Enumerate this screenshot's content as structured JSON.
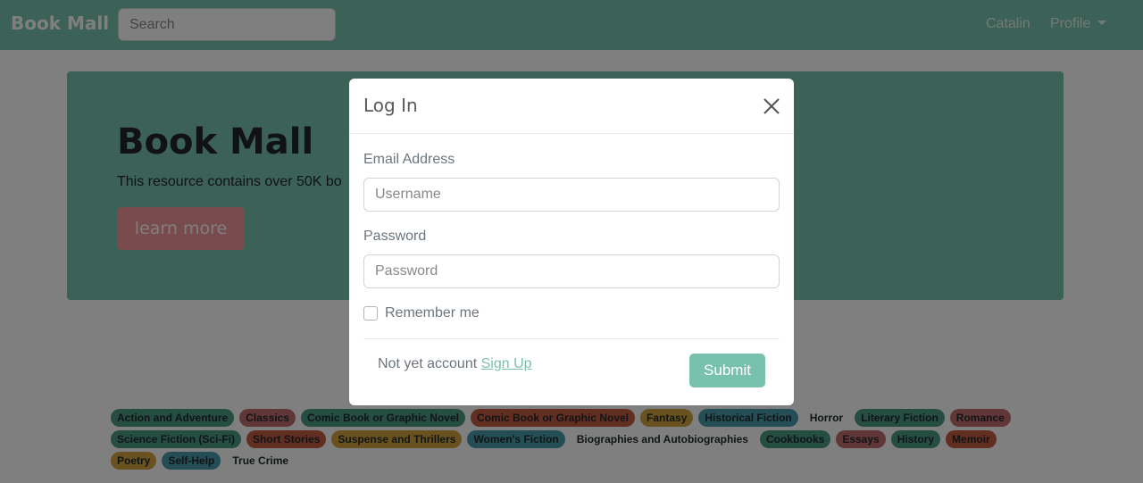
{
  "navbar": {
    "brand": "Book Mall",
    "search_placeholder": "Search",
    "user": "Catalin",
    "profile": "Profile"
  },
  "hero": {
    "title": "Book Mall",
    "text": "This resource contains over 50K bo",
    "button": "learn more"
  },
  "modal": {
    "title": "Log In",
    "email_label": "Email Address",
    "email_placeholder": "Username",
    "password_label": "Password",
    "password_placeholder": "Password",
    "remember_label": "Remember me",
    "signup_text": "Not yet account",
    "signup_link": "Sign Up",
    "submit": "Submit"
  },
  "tags": [
    {
      "label": "Action and Adventure",
      "color": "#4a9a84"
    },
    {
      "label": "Classics",
      "color": "#c06d71"
    },
    {
      "label": "Comic Book or Graphic Novel",
      "color": "#4a9a84"
    },
    {
      "label": "Comic Book or Graphic Novel",
      "color": "#c75c45"
    },
    {
      "label": "Fantasy",
      "color": "#d4a441"
    },
    {
      "label": "Historical Fiction",
      "color": "#4a9aaa"
    },
    {
      "label": "Horror",
      "color": ""
    },
    {
      "label": "Literary Fiction",
      "color": "#4a9a84"
    },
    {
      "label": "Romance",
      "color": "#c06d71"
    },
    {
      "label": "Science Fiction (Sci-Fi)",
      "color": "#4a9a84"
    },
    {
      "label": "Short Stories",
      "color": "#c75c45"
    },
    {
      "label": "Suspense and Thrillers",
      "color": "#d4a441"
    },
    {
      "label": "Women's Fiction",
      "color": "#4a9aaa"
    },
    {
      "label": "Biographies and Autobiographies",
      "color": ""
    },
    {
      "label": "Cookbooks",
      "color": "#4a9a84"
    },
    {
      "label": "Essays",
      "color": "#c06d71"
    },
    {
      "label": "History",
      "color": "#4a9a84"
    },
    {
      "label": "Memoir",
      "color": "#c75c45"
    },
    {
      "label": "Poetry",
      "color": "#d4a441"
    },
    {
      "label": "Self-Help",
      "color": "#4a9aaa"
    },
    {
      "label": "True Crime",
      "color": ""
    }
  ]
}
